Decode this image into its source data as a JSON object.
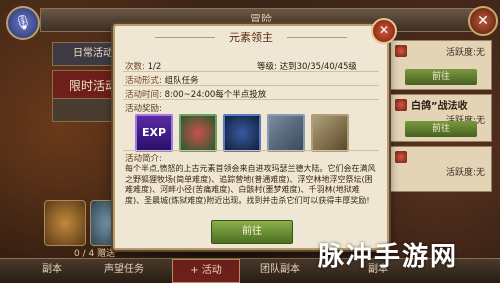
{
  "background": {
    "header_title": "冒险",
    "left_tabs": [
      "日常活动",
      "限时活动",
      ""
    ],
    "left_count": "0 / 4 赠送",
    "right_cards": [
      {
        "title": "",
        "status": "活跃度:无",
        "button": "前往"
      },
      {
        "title": "白鸽”战法收",
        "status": "活跃度:无",
        "button": "前往"
      },
      {
        "title": "",
        "status": "活跃度:无",
        "button": ""
      }
    ],
    "bottom_tabs": [
      "副本",
      "声望任务",
      "+ 活动",
      "团队副本",
      "副本"
    ]
  },
  "modal": {
    "title": "元素领主",
    "times_label": "次数:",
    "times_value": "1/2",
    "level_label": "等级:",
    "level_value": "达到30/35/40/45级",
    "form_label": "活动形式:",
    "form_value": "组队任务",
    "time_label": "活动时间:",
    "time_value": "8:00~24:00每个半点投放",
    "reward_label": "活动奖励:",
    "rewards": [
      {
        "name": "EXP",
        "icon": "exp-icon"
      },
      {
        "name": "",
        "icon": "red-gem-icon"
      },
      {
        "name": "",
        "icon": "blue-book-icon"
      },
      {
        "name": "",
        "icon": "scroll-icon"
      },
      {
        "name": "",
        "icon": "scroll-icon"
      }
    ],
    "intro_label": "活动简介:",
    "intro_text": "每个半点,愤怒的上古元素首领会来自进攻玛瑟兰德大陆。它们会在满风之野狐狸牧场(简单难度)、追踪营地(普通难度)、浮空林地浮空祭坛(困难难度)、河畔小径(苦痛难度)、白骸村(噩梦难度)、千羽林(地狱难度)、圣晨城(炼狱难度)附近出现。找到并击杀它们可以获得丰厚奖励!",
    "go_button": "前往"
  },
  "watermark": "脉冲手游网"
}
